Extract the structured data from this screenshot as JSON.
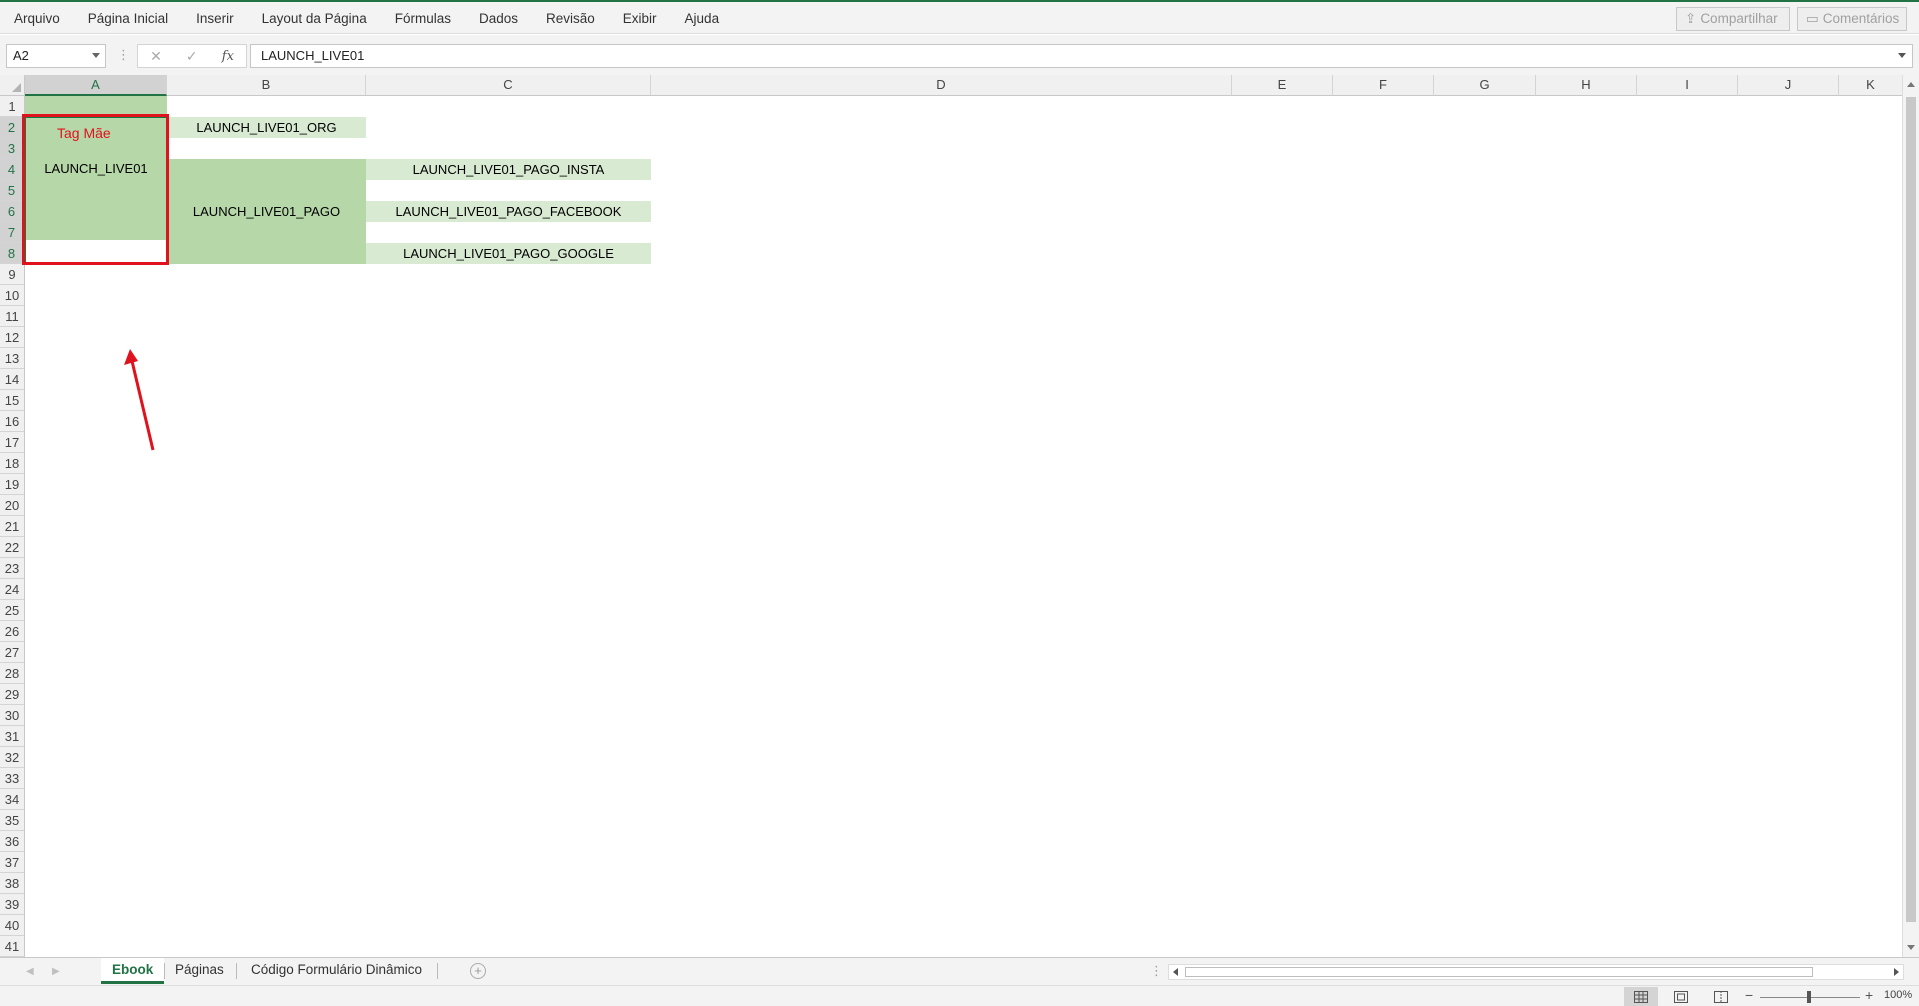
{
  "menu": [
    "Arquivo",
    "Página Inicial",
    "Inserir",
    "Layout da Página",
    "Fórmulas",
    "Dados",
    "Revisão",
    "Exibir",
    "Ajuda"
  ],
  "top_buttons": {
    "share": "Compartilhar",
    "comments": "Comentários"
  },
  "formula_bar": {
    "name_box": "A2",
    "formula": "LAUNCH_LIVE01",
    "fx": "fx"
  },
  "columns": [
    "A",
    "B",
    "C",
    "D",
    "E",
    "F",
    "G",
    "H",
    "I",
    "J",
    "K"
  ],
  "selected_column": "A",
  "rows": [
    "1",
    "2",
    "3",
    "4",
    "5",
    "6",
    "7",
    "8",
    "9",
    "10",
    "11",
    "12",
    "13",
    "14",
    "15",
    "16",
    "17",
    "18",
    "19",
    "20",
    "21",
    "22",
    "23",
    "24",
    "25",
    "26",
    "27",
    "28",
    "29",
    "30",
    "31",
    "32",
    "33",
    "34",
    "35",
    "36",
    "37",
    "38",
    "39",
    "40",
    "41"
  ],
  "selected_rows": [
    "2",
    "3",
    "4",
    "5",
    "6",
    "7",
    "8"
  ],
  "cells": {
    "a2": "LAUNCH_LIVE01",
    "b2": "LAUNCH_LIVE01_ORG",
    "b4": "LAUNCH_LIVE01_PAGO",
    "c4": "LAUNCH_LIVE01_PAGO_INSTA",
    "c6": "LAUNCH_LIVE01_PAGO_FACEBOOK",
    "c8": "LAUNCH_LIVE01_PAGO_GOOGLE"
  },
  "annotation": {
    "label": "Tag Mãe",
    "color": "#e0121d"
  },
  "sheet_tabs": [
    "Ebook",
    "Páginas",
    "Código Formulário Dinâmico"
  ],
  "active_sheet": "Ebook",
  "status": {
    "zoom": "100%"
  },
  "colors": {
    "excel_green": "#217346",
    "fill_dark": "#b6d7a8",
    "fill_light": "#d9ead3"
  }
}
